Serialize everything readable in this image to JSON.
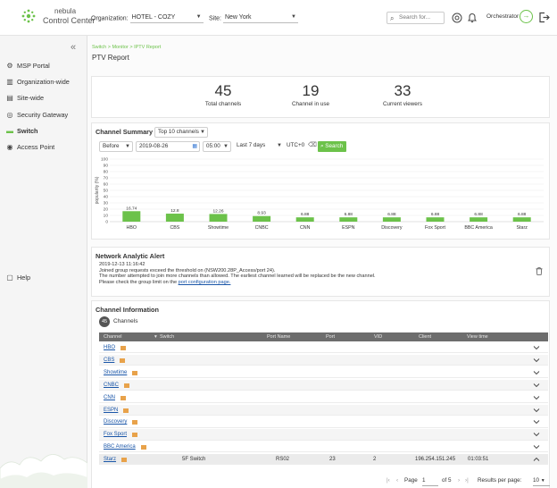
{
  "app": {
    "logo_line1": "nebula",
    "logo_line2": "Control Center"
  },
  "topbar": {
    "org_label": "Organization:",
    "org_value": "HOTEL - COZY",
    "site_label": "Site:",
    "site_value": "New York",
    "search_placeholder": "Search for...",
    "orchestrator_label": "Orchestrator"
  },
  "sidebar": {
    "collapse_glyph": "«",
    "items": [
      {
        "label": "MSP Portal"
      },
      {
        "label": "Organization-wide"
      },
      {
        "label": "Site-wide"
      },
      {
        "label": "Security Gateway"
      },
      {
        "label": "Switch"
      },
      {
        "label": "Access Point"
      },
      {
        "label": "Help"
      }
    ]
  },
  "breadcrumb": "Switch > Monitor > IPTV Report",
  "page_title": "PTV Report",
  "stats": [
    {
      "value": "45",
      "label": "Total channels"
    },
    {
      "value": "19",
      "label": "Channel in use"
    },
    {
      "value": "33",
      "label": "Current viewers"
    }
  ],
  "channel_summary": {
    "title": "Channel Summary",
    "top_select": "Top 10 channels",
    "before_select": "Before",
    "date_value": "2019-08-26",
    "time_value": "05:00",
    "range_select": "Last 7 days",
    "timezone": "UTC+0",
    "search_label": "Search"
  },
  "chart_data": {
    "type": "bar",
    "ylabel": "popularity (%)",
    "ylim": [
      0,
      100
    ],
    "yticks": [
      0,
      10,
      20,
      30,
      40,
      50,
      60,
      70,
      80,
      90,
      100
    ],
    "grid": true,
    "color": "#6cc24a",
    "categories": [
      "HBO",
      "CBS",
      "Showtime",
      "CNBC",
      "CNN",
      "ESPN",
      "Discovery",
      "Fox Sport",
      "BBC America",
      "Starz"
    ],
    "values": [
      16.74,
      12.8,
      12.26,
      8.93,
      6.88,
      6.88,
      6.88,
      6.88,
      6.88,
      6.88
    ],
    "value_labels": [
      "16.74",
      "12.8",
      "12.26",
      "8.93",
      "6.88",
      "6.88",
      "6.88",
      "6.88",
      "6.88",
      "6.88"
    ]
  },
  "alert": {
    "title": "Network Analytic Alert",
    "timestamp": "2019-12-13 11:16:42",
    "line1": "Joined group requests exceed the threshold on (NSW200.28P_Access/port 24).",
    "line2": "The number attempted to join more channels than allowed. The earliest channel learned will be replaced be the new channel.",
    "line3_prefix": "Please check the group limit on the ",
    "link": "port configuration page."
  },
  "channel_info": {
    "title": "Channel Information",
    "count": "45",
    "count_label": "Channels",
    "columns": [
      "Channel",
      "Switch",
      "Port Name",
      "Port",
      "VID",
      "Client",
      "View time"
    ],
    "rows": [
      {
        "channel": "HBO"
      },
      {
        "channel": "CBS"
      },
      {
        "channel": "Showtime"
      },
      {
        "channel": "CNBC"
      },
      {
        "channel": "CNN"
      },
      {
        "channel": "ESPN"
      },
      {
        "channel": "Discovery"
      },
      {
        "channel": "Fox Sport"
      },
      {
        "channel": "BBC America"
      }
    ],
    "expanded_row": {
      "channel": "Starz",
      "switch": "5F Switch",
      "port_name": "RS02",
      "port": "23",
      "vid": "2",
      "client": "196.254.151.245",
      "view_time": "01:03:51"
    },
    "pager": {
      "page_label": "Page",
      "page_value": "1",
      "of_label": "of 5",
      "results_label": "Results per page:",
      "results_value": "10"
    }
  },
  "colors": {
    "accent": "#6cc24a",
    "link": "#1a56a8",
    "table_header": "#6d6d6d"
  }
}
